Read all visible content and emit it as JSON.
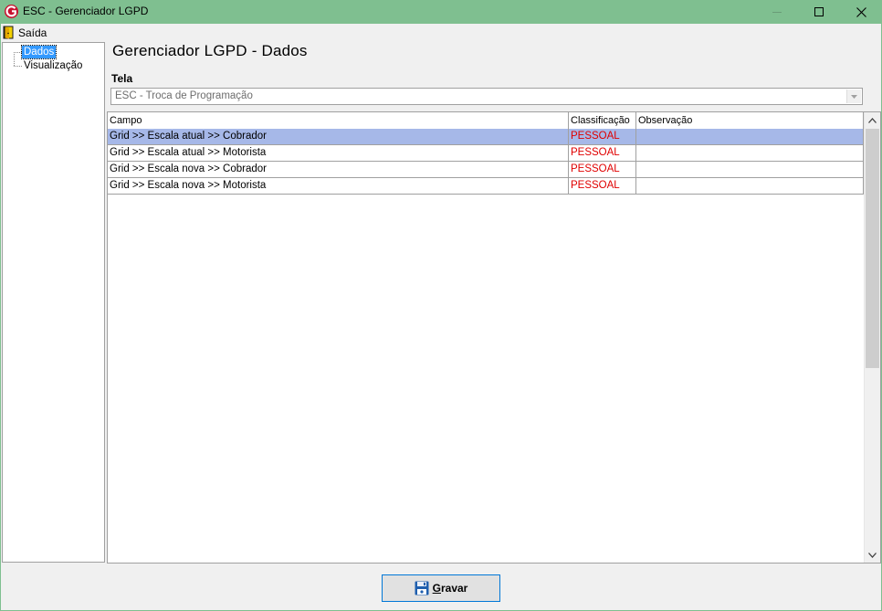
{
  "window": {
    "title": "ESC - Gerenciador LGPD",
    "accent_color": "#7fbf90",
    "icons": [
      "minimize-icon",
      "maximize-icon",
      "close-icon"
    ]
  },
  "menu": {
    "items": [
      {
        "label": "Saída",
        "icon": "exit-door-icon"
      }
    ]
  },
  "tree": {
    "items": [
      {
        "label": "Dados",
        "selected": true
      },
      {
        "label": "Visualização",
        "selected": false
      }
    ]
  },
  "main": {
    "heading": "Gerenciador LGPD - Dados",
    "tela_label": "Tela",
    "tela_value": "ESC - Troca de Programação"
  },
  "grid": {
    "columns": [
      "Campo",
      "Classificação",
      "Observação"
    ],
    "rows": [
      {
        "campo": "Grid >> Escala atual >> Cobrador",
        "classificacao": "PESSOAL",
        "observacao": "",
        "selected": true
      },
      {
        "campo": "Grid >> Escala atual >> Motorista",
        "classificacao": "PESSOAL",
        "observacao": "",
        "selected": false
      },
      {
        "campo": "Grid >> Escala nova >> Cobrador",
        "classificacao": "PESSOAL",
        "observacao": "",
        "selected": false
      },
      {
        "campo": "Grid >> Escala nova >> Motorista",
        "classificacao": "PESSOAL",
        "observacao": "",
        "selected": false
      }
    ],
    "classification_color": "#e00000",
    "selected_row_color": "#a6b8e8"
  },
  "footer": {
    "save_label": "Gravar",
    "save_icon": "floppy-disk-icon"
  }
}
